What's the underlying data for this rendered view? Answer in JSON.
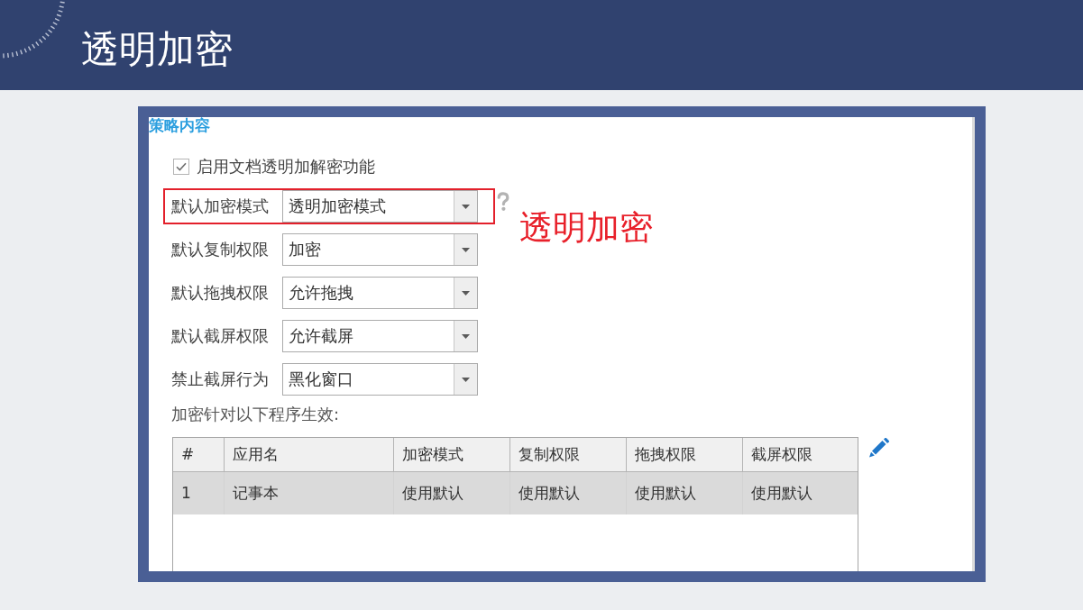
{
  "header": {
    "title": "透明加密"
  },
  "policy_panel": {
    "section_title": "策略内容",
    "enable_option": {
      "label": "启用文档透明加解密功能",
      "checked": true
    },
    "fields": [
      {
        "label": "默认加密模式",
        "value": "透明加密模式",
        "highlighted": true,
        "help": true
      },
      {
        "label": "默认复制权限",
        "value": "加密",
        "highlighted": false,
        "help": false
      },
      {
        "label": "默认拖拽权限",
        "value": "允许拖拽",
        "highlighted": false,
        "help": false
      },
      {
        "label": "默认截屏权限",
        "value": "允许截屏",
        "highlighted": false,
        "help": false
      },
      {
        "label": "禁止截屏行为",
        "value": "黑化窗口",
        "highlighted": false,
        "help": false
      }
    ],
    "program_list_label": "加密针对以下程序生效:",
    "table": {
      "columns": [
        "#",
        "应用名",
        "加密模式",
        "复制权限",
        "拖拽权限",
        "截屏权限"
      ],
      "rows": [
        {
          "cells": [
            "1",
            "记事本",
            "使用默认",
            "使用默认",
            "使用默认",
            "使用默认"
          ],
          "selected": true
        }
      ]
    }
  },
  "annotation": {
    "text": "透明加密"
  }
}
